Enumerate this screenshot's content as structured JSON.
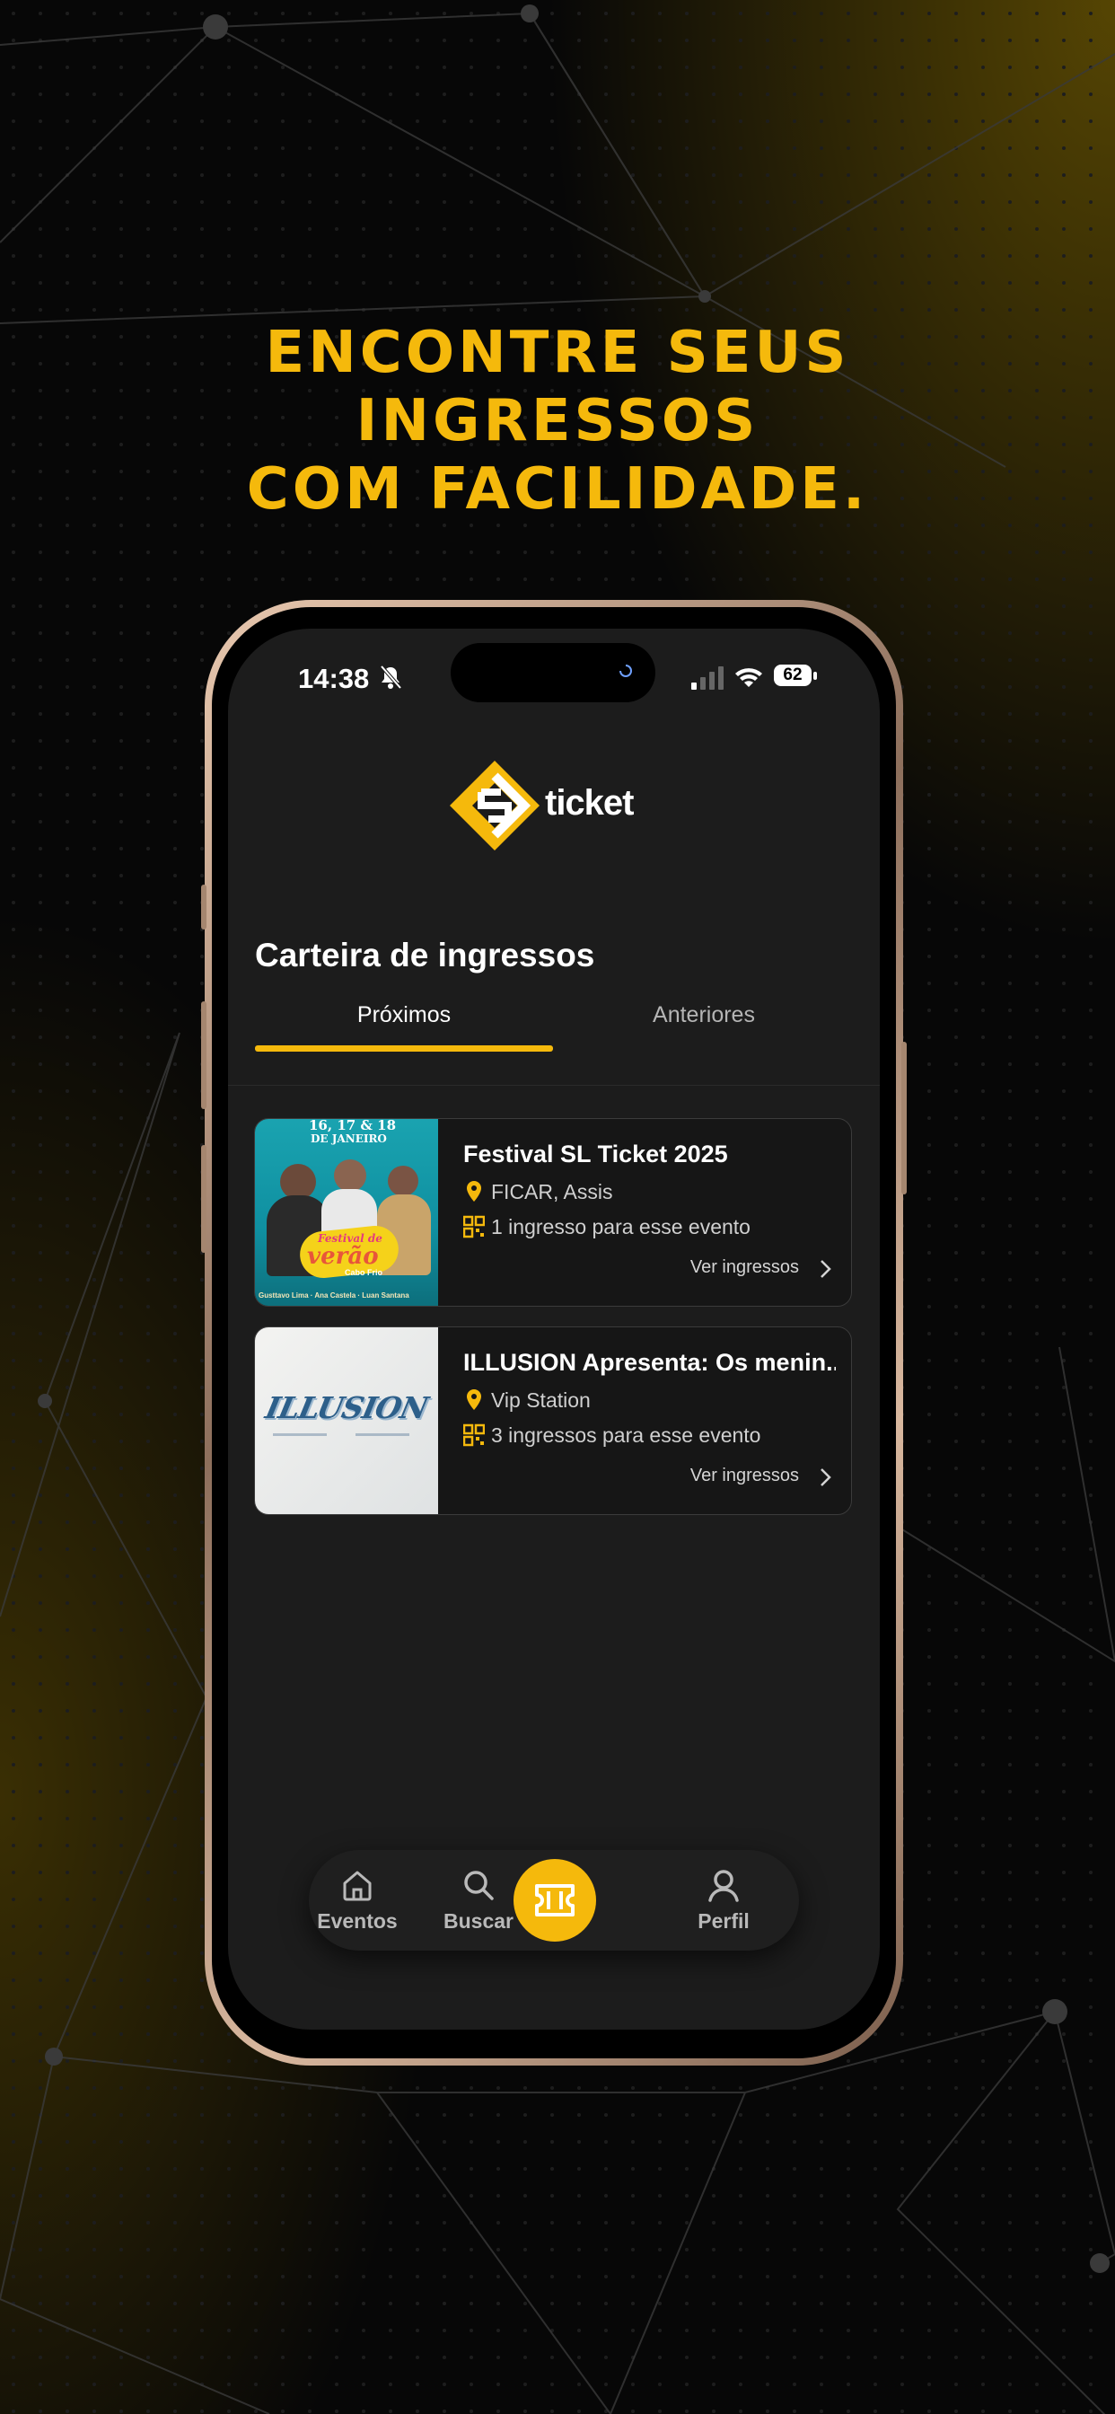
{
  "headline": [
    "ENCONTRE SEUS",
    "INGRESSOS",
    "COM FACILIDADE."
  ],
  "status_bar": {
    "time": "14:38",
    "battery": "62"
  },
  "logo": {
    "text": "ticket"
  },
  "wallet": {
    "title": "Carteira de ingressos",
    "tabs": [
      {
        "label": "Próximos",
        "active": true
      },
      {
        "label": "Anteriores",
        "active": false
      }
    ],
    "events": [
      {
        "title": "Festival SL Ticket 2025",
        "location": "FICAR, Assis",
        "tickets": "1 ingresso para esse evento",
        "action": "Ver ingressos",
        "poster": {
          "top": "16, 17 & 18",
          "top2": "DE JANEIRO",
          "brand": "Festival de",
          "brand2": "verão",
          "brand3": "Cabo Frio",
          "footer": "Gusttavo Lima · Ana Castela · Luan Santana"
        }
      },
      {
        "title": "ILLUSION Apresenta: Os menin...",
        "location": "Vip Station",
        "tickets": "3 ingressos para esse evento",
        "action": "Ver ingressos",
        "poster": {
          "word": "ILLUSION"
        }
      }
    ]
  },
  "nav": {
    "items": [
      {
        "label": "Eventos",
        "icon": "home-icon"
      },
      {
        "label": "Buscar",
        "icon": "search-icon"
      },
      {
        "label": "",
        "icon": "ticket-icon",
        "active": true
      },
      {
        "label": "Perfil",
        "icon": "user-icon"
      }
    ]
  },
  "colors": {
    "accent": "#f5b90c",
    "screen_bg": "#1c1c1c",
    "card_bg": "#161616"
  }
}
